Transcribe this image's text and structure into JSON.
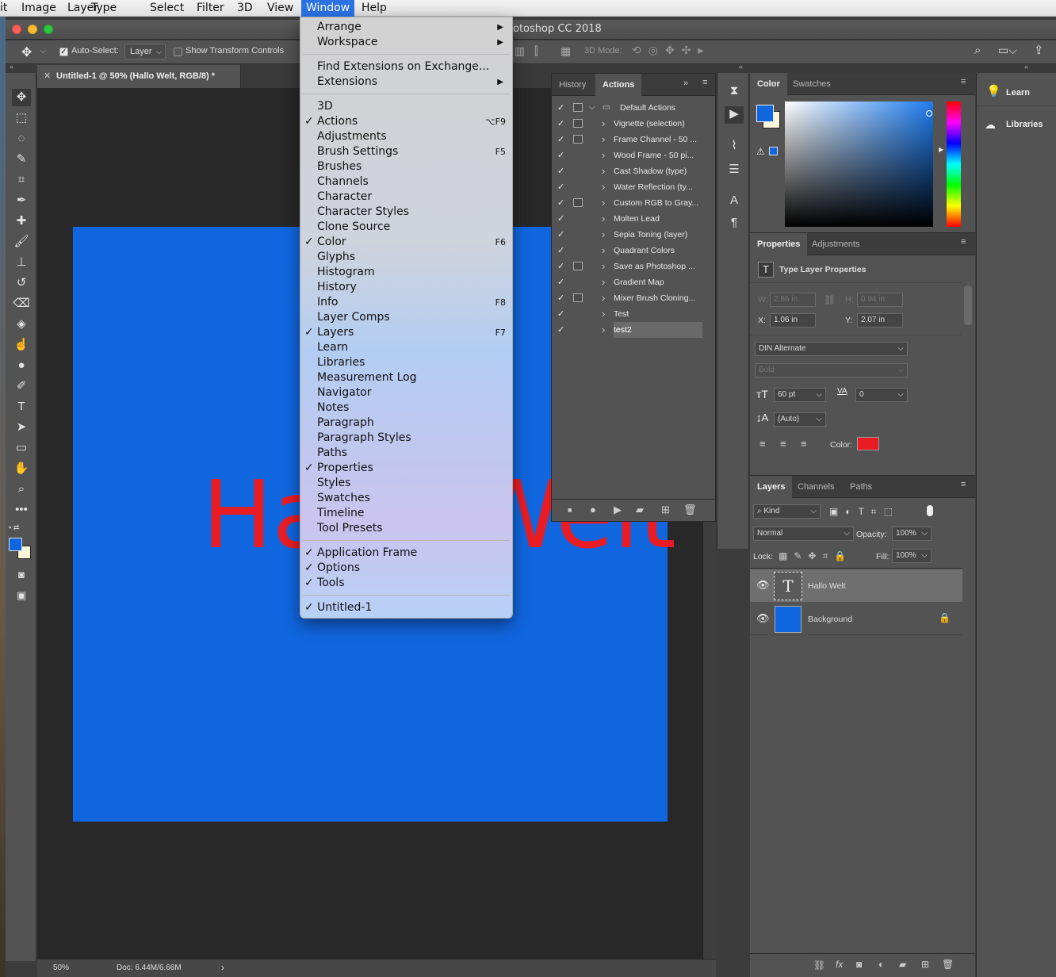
{
  "menubar": {
    "items": [
      "it",
      "Image",
      "Layer",
      "Type",
      "Select",
      "Filter",
      "3D",
      "View",
      "Window",
      "Help"
    ]
  },
  "window_title": "otoshop CC 2018",
  "options_bar": {
    "auto_select_label": "Auto-Select:",
    "auto_select_value": "Layer",
    "transform_label": "Show Transform Controls",
    "mode_3d_label": "3D Mode:"
  },
  "document": {
    "tab_title": "Untitled-1 @ 50% (Hallo Welt, RGB/8) *",
    "canvas_text": "Hallo Welt",
    "canvas_color": "#1066df",
    "text_color": "#e91c24",
    "zoom": "50%",
    "doc_size": "Doc: 6.44M/6.66M"
  },
  "window_menu": {
    "section1": [
      {
        "label": "Arrange",
        "submenu": true
      },
      {
        "label": "Workspace",
        "submenu": true
      }
    ],
    "section2": [
      {
        "label": "Find Extensions on Exchange...",
        "submenu": false
      },
      {
        "label": "Extensions",
        "submenu": true
      }
    ],
    "section3": [
      {
        "label": "3D",
        "checked": false,
        "shortcut": ""
      },
      {
        "label": "Actions",
        "checked": true,
        "shortcut": "⌥F9"
      },
      {
        "label": "Adjustments",
        "checked": false,
        "shortcut": ""
      },
      {
        "label": "Brush Settings",
        "checked": false,
        "shortcut": "F5"
      },
      {
        "label": "Brushes",
        "checked": false,
        "shortcut": ""
      },
      {
        "label": "Channels",
        "checked": false,
        "shortcut": ""
      },
      {
        "label": "Character",
        "checked": false,
        "shortcut": ""
      },
      {
        "label": "Character Styles",
        "checked": false,
        "shortcut": ""
      },
      {
        "label": "Clone Source",
        "checked": false,
        "shortcut": ""
      },
      {
        "label": "Color",
        "checked": true,
        "shortcut": "F6"
      },
      {
        "label": "Glyphs",
        "checked": false,
        "shortcut": ""
      },
      {
        "label": "Histogram",
        "checked": false,
        "shortcut": ""
      },
      {
        "label": "History",
        "checked": false,
        "shortcut": ""
      },
      {
        "label": "Info",
        "checked": false,
        "shortcut": "F8"
      },
      {
        "label": "Layer Comps",
        "checked": false,
        "shortcut": ""
      },
      {
        "label": "Layers",
        "checked": true,
        "shortcut": "F7"
      },
      {
        "label": "Learn",
        "checked": false,
        "shortcut": ""
      },
      {
        "label": "Libraries",
        "checked": false,
        "shortcut": ""
      },
      {
        "label": "Measurement Log",
        "checked": false,
        "shortcut": ""
      },
      {
        "label": "Navigator",
        "checked": false,
        "shortcut": ""
      },
      {
        "label": "Notes",
        "checked": false,
        "shortcut": ""
      },
      {
        "label": "Paragraph",
        "checked": false,
        "shortcut": ""
      },
      {
        "label": "Paragraph Styles",
        "checked": false,
        "shortcut": ""
      },
      {
        "label": "Paths",
        "checked": false,
        "shortcut": ""
      },
      {
        "label": "Properties",
        "checked": true,
        "shortcut": ""
      },
      {
        "label": "Styles",
        "checked": false,
        "shortcut": ""
      },
      {
        "label": "Swatches",
        "checked": false,
        "shortcut": ""
      },
      {
        "label": "Timeline",
        "checked": false,
        "shortcut": ""
      },
      {
        "label": "Tool Presets",
        "checked": false,
        "shortcut": ""
      }
    ],
    "section4": [
      {
        "label": "Application Frame",
        "checked": true
      },
      {
        "label": "Options",
        "checked": true
      },
      {
        "label": "Tools",
        "checked": true
      }
    ],
    "section5": [
      {
        "label": "Untitled-1",
        "checked": true
      }
    ]
  },
  "actions_panel": {
    "tabs": [
      "History",
      "Actions"
    ],
    "rows": [
      {
        "name": "Default Actions",
        "dialog": true,
        "set": true
      },
      {
        "name": "Vignette (selection)",
        "dialog": true
      },
      {
        "name": "Frame Channel - 50 ...",
        "dialog": true
      },
      {
        "name": "Wood Frame - 50 pi...",
        "dialog": false
      },
      {
        "name": "Cast Shadow (type)",
        "dialog": false
      },
      {
        "name": "Water Reflection (ty...",
        "dialog": false
      },
      {
        "name": "Custom RGB to Gray...",
        "dialog": true
      },
      {
        "name": "Molten Lead",
        "dialog": false
      },
      {
        "name": "Sepia Toning (layer)",
        "dialog": false
      },
      {
        "name": "Quadrant Colors",
        "dialog": false
      },
      {
        "name": "Save as Photoshop ...",
        "dialog": true
      },
      {
        "name": "Gradient Map",
        "dialog": false
      },
      {
        "name": "Mixer Brush Cloning...",
        "dialog": true
      },
      {
        "name": "Test",
        "dialog": false
      },
      {
        "name": "test2",
        "dialog": false,
        "selected": true
      }
    ]
  },
  "color_panel": {
    "tabs": [
      "Color",
      "Swatches"
    ],
    "foreground": "#1066df",
    "background": "#fbf6d9"
  },
  "properties_panel": {
    "tabs": [
      "Properties",
      "Adjustments"
    ],
    "header": "Type Layer Properties",
    "w_label": "W:",
    "w_value": "2.86 in",
    "h_label": "H:",
    "h_value": "0.94 in",
    "x_label": "X:",
    "x_value": "1.06 in",
    "y_label": "Y:",
    "y_value": "2.07 in",
    "font": "DIN Alternate",
    "style": "Bold",
    "size": "60 pt",
    "tracking": "0",
    "leading": "(Auto)",
    "color_label": "Color:",
    "text_color": "#e91c24"
  },
  "layers_panel": {
    "tabs": [
      "Layers",
      "Channels",
      "Paths"
    ],
    "filter": "Kind",
    "blend_mode": "Normal",
    "opacity_label": "Opacity:",
    "opacity": "100%",
    "lock_label": "Lock:",
    "fill_label": "Fill:",
    "fill": "100%",
    "layers": [
      {
        "name": "Hallo Welt",
        "type": "text"
      },
      {
        "name": "Background",
        "type": "image",
        "locked": true
      }
    ]
  },
  "learn_panel": {
    "items": [
      "Learn",
      "Libraries"
    ]
  }
}
